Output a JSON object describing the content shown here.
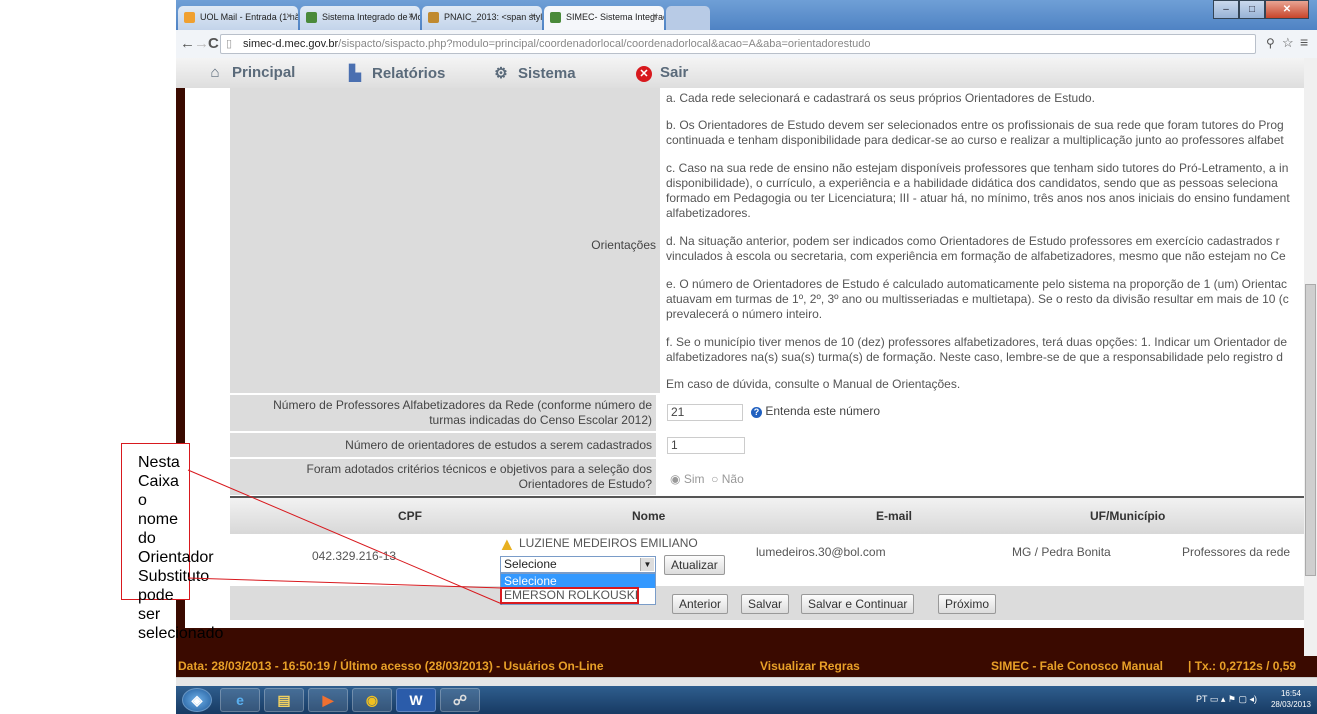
{
  "browser": {
    "tabs": [
      {
        "title": "UOL Mail - Entrada (1 não"
      },
      {
        "title": "Sistema Integrado de Mo"
      },
      {
        "title": "PNAIC_2013: <span style"
      },
      {
        "title": "SIMEC- Sistema Integrado"
      }
    ],
    "url_host": "simec-d.mec.gov.br",
    "url_path": "/sispacto/sispacto.php?modulo=principal/coordenadorlocal/coordenadorlocal&acao=A&aba=orientadorestudo",
    "close_symbol": "×"
  },
  "nav": {
    "principal": "Principal",
    "relatorios": "Relatórios",
    "sistema": "Sistema",
    "sair": "Sair"
  },
  "form": {
    "orientacoes_label": "Orientações",
    "instructions": [
      "a. Cada rede selecionará e cadastrará os seus próprios Orientadores de Estudo.",
      "b. Os Orientadores de Estudo devem ser selecionados entre os profissionais de sua rede que foram tutores do Prog",
      "continuada e tenham disponibilidade para dedicar-se ao curso e realizar a multiplicação junto ao professores alfabet",
      "c. Caso na sua rede de ensino não estejam disponíveis professores que tenham sido tutores do Pró-Letramento, a in",
      "disponibilidade), o currículo, a experiência e a habilidade didática dos candidatos, sendo que as pessoas seleciona",
      "formado em Pedagogia ou ter Licenciatura; III - atuar há, no mínimo, três anos nos anos iniciais do ensino fundament",
      "alfabetizadores.",
      "d. Na situação anterior, podem ser indicados como Orientadores de Estudo professores em exercício cadastrados r",
      "vinculados à escola ou secretaria, com experiência em formação de alfabetizadores, mesmo que não estejam no Ce",
      "e. O número de Orientadores de Estudo é calculado automaticamente pelo sistema na proporção de 1 (um) Orientac",
      "atuavam em turmas de 1º, 2º, 3º ano ou multisseriadas e multietapa). Se o resto da divisão resultar em mais de 10 (c",
      "prevalecerá o número inteiro.",
      "f. Se o município tiver menos de 10 (dez) professores alfabetizadores, terá duas opções: 1. Indicar um Orientador de",
      "alfabetizadores na(s) sua(s) turma(s) de formação. Neste caso, lembre-se de que a responsabilidade pelo registro d",
      "Em caso de dúvida, consulte o Manual de Orientações."
    ],
    "num_professores_label_1": "Número de Professores Alfabetizadores da Rede (conforme número de",
    "num_professores_label_2": "turmas indicadas do Censo Escolar 2012)",
    "num_professores_value": "21",
    "entenda_link": "Entenda este número",
    "num_orientadores_label": "Número de orientadores de estudos a serem cadastrados",
    "num_orientadores_value": "1",
    "criterios_label_1": "Foram adotados critérios técnicos e objetivos para a seleção dos",
    "criterios_label_2": "Orientadores de Estudo?",
    "radio_sim": "Sim",
    "radio_nao": "Não"
  },
  "table": {
    "headers": [
      "CPF",
      "Nome",
      "E-mail",
      "UF/Município"
    ],
    "row": {
      "cpf": "042.329.216-13",
      "nome": "LUZIENE MEDEIROS EMILIANO",
      "email": "lumedeiros.30@bol.com",
      "uf": "MG / Pedra Bonita",
      "funcao": "Professores da rede"
    },
    "select_value": "Selecione",
    "select_options": [
      "Selecione",
      "EMERSON ROLKOUSKI"
    ],
    "atualizar_label": "Atualizar"
  },
  "buttons": {
    "anterior": "Anterior",
    "salvar": "Salvar",
    "salvar_continuar": "Salvar e Continuar",
    "proximo": "Próximo"
  },
  "footer": {
    "left": "Data: 28/03/2013 - 16:50:19 / Último acesso (28/03/2013) - Usuários On-Line",
    "middle": "Visualizar Regras",
    "right": "SIMEC - Fale Conosco Manual",
    "tx": "| Tx.: 0,2712s / 0,59"
  },
  "taskbar": {
    "lang": "PT",
    "time": "16:54",
    "date": "28/03/2013"
  },
  "callout": {
    "text": "Nesta Caixa o nome do Orientador Substituto pode ser selecionado"
  },
  "colors": {
    "frame_dark": "#3a0a00",
    "footer_text": "#e8a028",
    "highlight_red": "#d8191e",
    "selection_blue": "#3399ff"
  }
}
